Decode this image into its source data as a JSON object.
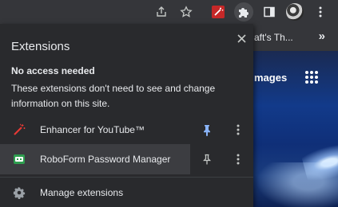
{
  "popup": {
    "title": "Extensions",
    "section_title": "No access needed",
    "section_desc": "These extensions don't need to see and change information on this site.",
    "extensions": [
      {
        "name": "Enhancer for YouTube™",
        "icon": "magic-wand-icon",
        "pinned": true
      },
      {
        "name": "RoboForm Password Manager",
        "icon": "roboform-icon",
        "pinned": false
      }
    ],
    "manage_label": "Manage extensions"
  },
  "background": {
    "bookmark_label": "aft's Th...",
    "bookmarks_more": "»",
    "page_label": "mages"
  },
  "colors": {
    "popup_bg": "#292a2d",
    "toolbar_bg": "#35363a",
    "text": "#e8eaed",
    "pin_active": "#8ab4f8",
    "enhancer_red": "#d32f2f",
    "roboform_green": "#2e9e4f"
  }
}
